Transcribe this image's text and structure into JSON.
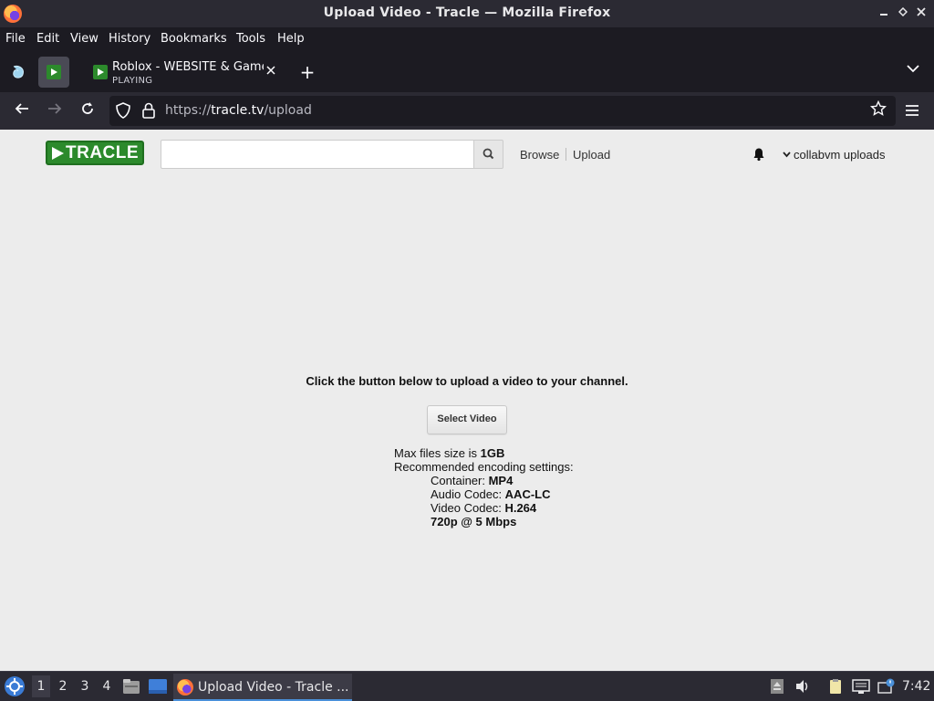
{
  "window": {
    "title": "Upload Video - Tracle — Mozilla Firefox",
    "minimize_glyph": "▁",
    "maximize_glyph": "◇",
    "close_glyph": "✕"
  },
  "menu": {
    "file": "File",
    "edit": "Edit",
    "view": "View",
    "history": "History",
    "bookmarks": "Bookmarks",
    "tools": "Tools",
    "help": "Help"
  },
  "tabs": {
    "active": {
      "title": "Roblox - WEBSITE & Gameplay",
      "status": "PLAYING",
      "close_glyph": "✕"
    },
    "new_tab_glyph": "+",
    "list_all_glyph": "⌄"
  },
  "nav": {
    "back_glyph": "←",
    "forward_glyph": "→",
    "reload_glyph": "↻",
    "url_scheme": "https://",
    "url_host": "tracle.tv",
    "url_path": "/upload",
    "bookmark_glyph": "☆"
  },
  "site": {
    "logo_text": "TRACLE",
    "search_placeholder": "",
    "browse": "Browse",
    "upload": "Upload",
    "username": "collabvm uploads",
    "caret": "⌄"
  },
  "upload": {
    "prompt": "Click the button below to upload a video to your channel.",
    "button": "Select Video",
    "max_size_label": "Max files size is ",
    "max_size_value": "1GB",
    "recommended": "Recommended encoding settings:",
    "container_label": "Container: ",
    "container_value": "MP4",
    "audio_label": "Audio Codec: ",
    "audio_value": "AAC-LC",
    "video_label": "Video Codec: ",
    "video_value": "H.264",
    "resolution": "720p @ 5 Mbps"
  },
  "taskbar": {
    "workspaces": [
      "1",
      "2",
      "3",
      "4"
    ],
    "task_label": "Upload Video - Tracle ...",
    "clock": "7:42"
  },
  "colors": {
    "brand_green": "#2c8a2c",
    "chrome_dark": "#1c1b22",
    "chrome_mid": "#2b2a33",
    "page_bg": "#ececec"
  }
}
